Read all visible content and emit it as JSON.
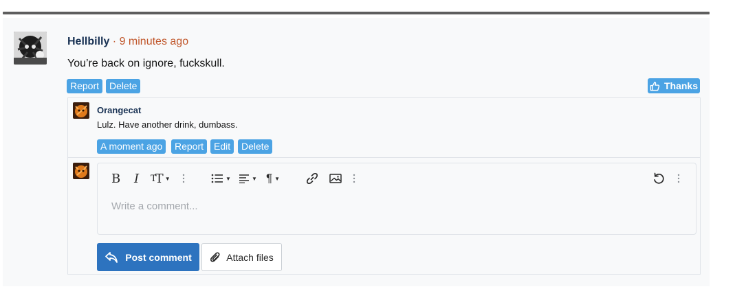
{
  "post": {
    "username": "Hellbilly",
    "separator": " · ",
    "timestamp": "9 minutes ago",
    "body": "You’re back on ignore, fuckskull.",
    "actions": {
      "report": "Report",
      "delete": "Delete"
    },
    "thanks_label": "Thanks"
  },
  "reply": {
    "username": "Orangecat",
    "body": "Lulz. Have another drink, dumbass.",
    "actions": {
      "timestamp": "A moment ago",
      "report": "Report",
      "edit": "Edit",
      "delete": "Delete"
    }
  },
  "composer": {
    "placeholder": "Write a comment...",
    "toolbar": [
      "bold-icon",
      "italic-icon",
      "text-size-icon",
      "more-vertical-icon",
      "bulleted-list-icon",
      "align-icon",
      "paragraph-icon",
      "more-vertical-icon",
      "link-icon",
      "image-icon",
      "more-vertical-icon",
      "undo-icon",
      "more-vertical-icon"
    ],
    "post_button": "Post comment",
    "attach_button": "Attach files"
  },
  "colors": {
    "accent": "#4ba3e4",
    "primary": "#2d73bf",
    "username": "#183153",
    "timestamp": "#c0562a"
  }
}
